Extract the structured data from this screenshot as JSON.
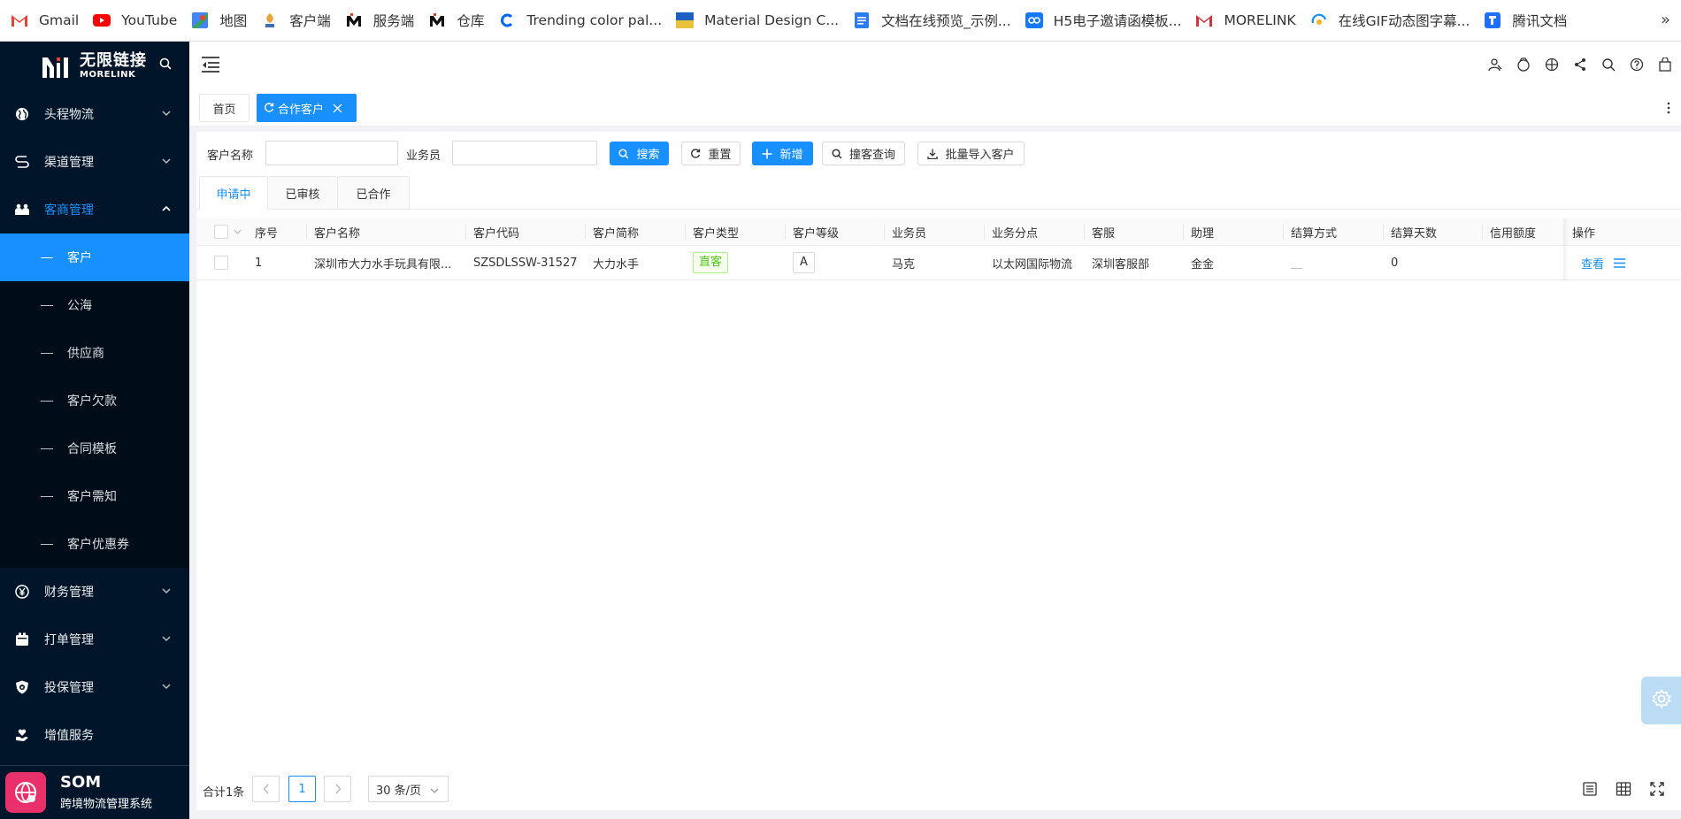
{
  "bookmarks": [
    {
      "label": "Gmail",
      "icon": "gmail-icon"
    },
    {
      "label": "YouTube",
      "icon": "youtube-icon"
    },
    {
      "label": "地图",
      "icon": "maps-icon"
    },
    {
      "label": "客户端",
      "icon": "client-icon"
    },
    {
      "label": "服务端",
      "icon": "server-icon"
    },
    {
      "label": "仓库",
      "icon": "warehouse-icon"
    },
    {
      "label": "Trending color pal...",
      "icon": "coolors-icon"
    },
    {
      "label": "Material Design C...",
      "icon": "material-icon"
    },
    {
      "label": "文档在线预览_示例...",
      "icon": "doc-icon"
    },
    {
      "label": "H5电子邀请函模板...",
      "icon": "h5-icon"
    },
    {
      "label": "MORELINK",
      "icon": "morelink-icon"
    },
    {
      "label": "在线GIF动态图字幕...",
      "icon": "gif-icon"
    },
    {
      "label": "腾讯文档",
      "icon": "tencent-docs-icon"
    }
  ],
  "bookmarks_more": "»",
  "sidebar": {
    "logo_cn": "无限链接",
    "logo_en": "MORELINK",
    "items": [
      {
        "label": "头程物流",
        "icon": "globe-icon"
      },
      {
        "label": "渠道管理",
        "icon": "route-icon"
      },
      {
        "label": "客商管理",
        "icon": "customers-icon",
        "open": true
      }
    ],
    "sub_items": [
      {
        "label": "客户",
        "active": true
      },
      {
        "label": "公海"
      },
      {
        "label": "供应商"
      },
      {
        "label": "客户欠款"
      },
      {
        "label": "合同模板"
      },
      {
        "label": "客户需知"
      },
      {
        "label": "客户优惠券"
      }
    ],
    "items_after": [
      {
        "label": "财务管理",
        "icon": "yen-icon"
      },
      {
        "label": "打单管理",
        "icon": "print-icon"
      },
      {
        "label": "投保管理",
        "icon": "shield-icon"
      },
      {
        "label": "增值服务",
        "icon": "heart-hand-icon"
      }
    ],
    "footer_name": "SOM",
    "footer_desc": "跨境物流管理系统"
  },
  "page_tabs": {
    "home": "首页",
    "active": "合作客户"
  },
  "search": {
    "customer_name_label": "客户名称",
    "customer_name_value": "",
    "salesman_label": "业务员",
    "salesman_value": "",
    "btn_search": "搜索",
    "btn_reset": "重置",
    "btn_add": "新增",
    "btn_check": "撞客查询",
    "btn_import": "批量导入客户"
  },
  "status_tabs": [
    "申请中",
    "已审核",
    "已合作"
  ],
  "table": {
    "columns": [
      "序号",
      "客户名称",
      "客户代码",
      "客户简称",
      "客户类型",
      "客户等级",
      "业务员",
      "业务分点",
      "客服",
      "助理",
      "结算方式",
      "结算天数",
      "信用额度",
      "操作"
    ],
    "rows": [
      {
        "index": "1",
        "name": "深圳市大力水手玩具有限...",
        "code": "SZSDLSSW-31527",
        "short_name": "大力水手",
        "type": "直客",
        "level": "A",
        "salesman": "马克",
        "branch": "以太网国际物流",
        "service": "深圳客服部",
        "assistant": "金金",
        "settle_method": "__",
        "settle_days": "0",
        "credit": "",
        "action_view": "查看"
      }
    ]
  },
  "pagination": {
    "total": "合计1条",
    "current_page": "1",
    "page_size": "30 条/页"
  },
  "colors": {
    "sidebar_bg": "#001529",
    "accent": "#1890ff",
    "tag_green": "#52c41a",
    "sys_logo": "#e8306a"
  }
}
